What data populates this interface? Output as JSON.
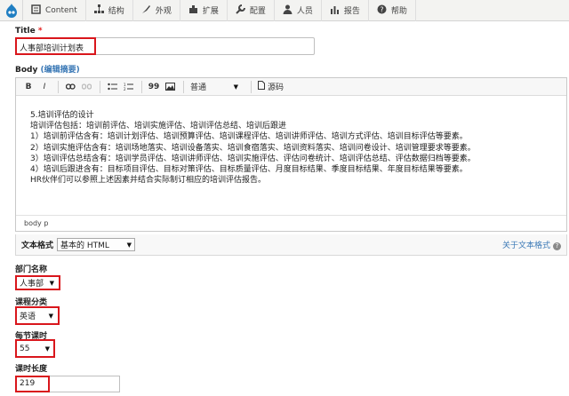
{
  "toolbar": {
    "items": [
      {
        "label": "Content",
        "icon": "content-icon"
      },
      {
        "label": "结构",
        "icon": "structure-icon"
      },
      {
        "label": "外观",
        "icon": "appearance-icon"
      },
      {
        "label": "扩展",
        "icon": "extend-icon"
      },
      {
        "label": "配置",
        "icon": "wrench-icon"
      },
      {
        "label": "人员",
        "icon": "people-icon"
      },
      {
        "label": "报告",
        "icon": "reports-icon"
      },
      {
        "label": "帮助",
        "icon": "help-icon"
      }
    ]
  },
  "title_field": {
    "label": "Title",
    "required_mark": "*",
    "value": "人事部培训计划表"
  },
  "body_field": {
    "label": "Body",
    "summary_link_open": "(",
    "summary_link": "编辑摘要",
    "summary_link_close": ")",
    "editor_toolbar": {
      "bold": "B",
      "italic": "I",
      "quote": "99",
      "format_select": "普通",
      "source_label": "源码"
    },
    "content_lines": [
      "5.培训评估的设计",
      "培训评估包括：培训前评估、培训实施评估、培训评估总结、培训后跟进",
      "1）培训前评估含有：培训计划评估、培训预算评估、培训课程评估、培训讲师评估、培训方式评估、培训目标评估等要素。",
      "2）培训实施评估含有：培训场地落实、培训设备落实、培训食宿落实、培训资料落实、培训问卷设计、培训管理要求等要素。",
      "3）培训评估总结含有：培训学员评估、培训讲师评估、培训实施评估、评估问卷统计、培训评估总结、评估数据归档等要素。",
      "4）培训后跟进含有：目标项目评估、目标对策评估、目标质量评估、月度目标结果、季度目标结果、年度目标结果等要素。",
      "HR伙伴们可以参照上述因素并结合实际制订相应的培训评估报告。"
    ],
    "path_text": "body  p"
  },
  "text_format": {
    "label": "文本格式",
    "selected": "基本的 HTML",
    "about_link": "关于文本格式",
    "help_glyph": "?"
  },
  "department": {
    "label": "部门名称",
    "selected": "人事部"
  },
  "course_category": {
    "label": "课程分类",
    "selected": "英语"
  },
  "hours_per_session": {
    "label": "每节课时",
    "selected": "55"
  },
  "duration": {
    "label": "课时长度",
    "value": "219"
  }
}
